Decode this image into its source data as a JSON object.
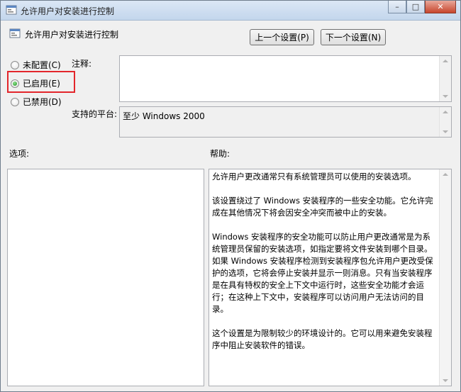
{
  "window": {
    "title": "允许用户对安装进行控制"
  },
  "header": {
    "policy_title": "允许用户对安装进行控制",
    "prev_button": "上一个设置(P)",
    "next_button": "下一个设置(N)"
  },
  "state": {
    "options": [
      {
        "label": "未配置(C)",
        "checked": false
      },
      {
        "label": "已启用(E)",
        "checked": true
      },
      {
        "label": "已禁用(D)",
        "checked": false
      }
    ],
    "highlight_color": "#e3262b"
  },
  "labels": {
    "comment": "注释:",
    "platform": "支持的平台:",
    "options": "选项:",
    "help": "帮助:"
  },
  "comment": {
    "value": ""
  },
  "platform": {
    "value": "至少 Windows 2000"
  },
  "help": {
    "paragraphs": [
      "允许用户更改通常只有系统管理员可以使用的安装选项。",
      "该设置绕过了 Windows 安装程序的一些安全功能。它允许完成在其他情况下将会因安全冲突而被中止的安装。",
      "Windows 安装程序的安全功能可以防止用户更改通常是为系统管理员保留的安装选项，如指定要将文件安装到哪个目录。如果 Windows 安装程序检测到安装程序包允许用户更改受保护的选项，它将会停止安装并显示一则消息。只有当安装程序是在具有特权的安全上下文中运行时，这些安全功能才会运行；在这种上下文中，安装程序可以访问用户无法访问的目录。",
      "这个设置是为限制较少的环境设计的。它可以用来避免安装程序中阻止安装软件的错误。"
    ]
  }
}
